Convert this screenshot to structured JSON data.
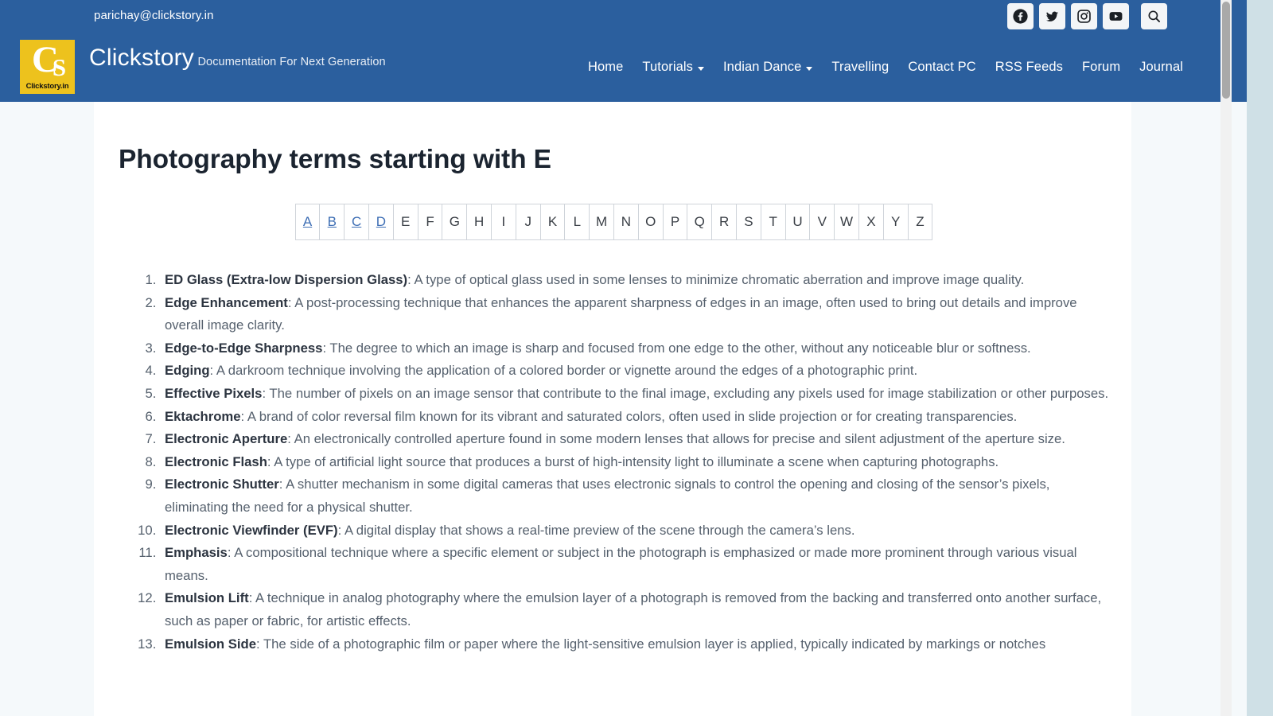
{
  "topbar": {
    "email": "parichay@clickstory.in",
    "social": [
      {
        "name": "facebook-icon",
        "label": "Facebook"
      },
      {
        "name": "twitter-icon",
        "label": "Twitter"
      },
      {
        "name": "instagram-icon",
        "label": "Instagram"
      },
      {
        "name": "youtube-icon",
        "label": "YouTube"
      }
    ],
    "search_label": "Search"
  },
  "header": {
    "logo_letters": "CS",
    "logo_caption": "Clickstory.in",
    "site_title": "Clickstory",
    "tagline": "Documentation For Next Generation",
    "nav": [
      {
        "label": "Home",
        "has_caret": false
      },
      {
        "label": "Tutorials",
        "has_caret": true
      },
      {
        "label": "Indian Dance",
        "has_caret": true
      },
      {
        "label": "Travelling",
        "has_caret": false
      },
      {
        "label": "Contact PC",
        "has_caret": false
      },
      {
        "label": "RSS Feeds",
        "has_caret": false
      },
      {
        "label": "Forum",
        "has_caret": false
      },
      {
        "label": "Journal",
        "has_caret": false
      }
    ]
  },
  "main": {
    "title": "Photography terms starting with E",
    "alphabet": [
      {
        "letter": "A",
        "linked": true
      },
      {
        "letter": "B",
        "linked": true
      },
      {
        "letter": "C",
        "linked": true
      },
      {
        "letter": "D",
        "linked": true
      },
      {
        "letter": "E",
        "linked": false
      },
      {
        "letter": "F",
        "linked": false
      },
      {
        "letter": "G",
        "linked": false
      },
      {
        "letter": "H",
        "linked": false
      },
      {
        "letter": "I",
        "linked": false
      },
      {
        "letter": "J",
        "linked": false
      },
      {
        "letter": "K",
        "linked": false
      },
      {
        "letter": "L",
        "linked": false
      },
      {
        "letter": "M",
        "linked": false
      },
      {
        "letter": "N",
        "linked": false
      },
      {
        "letter": "O",
        "linked": false
      },
      {
        "letter": "P",
        "linked": false
      },
      {
        "letter": "Q",
        "linked": false
      },
      {
        "letter": "R",
        "linked": false
      },
      {
        "letter": "S",
        "linked": false
      },
      {
        "letter": "T",
        "linked": false
      },
      {
        "letter": "U",
        "linked": false
      },
      {
        "letter": "V",
        "linked": false
      },
      {
        "letter": "W",
        "linked": false
      },
      {
        "letter": "X",
        "linked": false
      },
      {
        "letter": "Y",
        "linked": false
      },
      {
        "letter": "Z",
        "linked": false
      }
    ],
    "terms": [
      {
        "term": "ED Glass (Extra-low Dispersion Glass)",
        "definition": ": A type of optical glass used in some lenses to minimize chromatic aberration and improve image quality."
      },
      {
        "term": "Edge Enhancement",
        "definition": ": A post-processing technique that enhances the apparent sharpness of edges in an image, often used to bring out details and improve overall image clarity."
      },
      {
        "term": "Edge-to-Edge Sharpness",
        "definition": ": The degree to which an image is sharp and focused from one edge to the other, without any noticeable blur or softness."
      },
      {
        "term": "Edging",
        "definition": ": A darkroom technique involving the application of a colored border or vignette around the edges of a photographic print."
      },
      {
        "term": "Effective Pixels",
        "definition": ": The number of pixels on an image sensor that contribute to the final image, excluding any pixels used for image stabilization or other purposes."
      },
      {
        "term": "Ektachrome",
        "definition": ": A brand of color reversal film known for its vibrant and saturated colors, often used in slide projection or for creating transparencies."
      },
      {
        "term": "Electronic Aperture",
        "definition": ": An electronically controlled aperture found in some modern lenses that allows for precise and silent adjustment of the aperture size."
      },
      {
        "term": "Electronic Flash",
        "definition": ": A type of artificial light source that produces a burst of high-intensity light to illuminate a scene when capturing photographs."
      },
      {
        "term": "Electronic Shutter",
        "definition": ": A shutter mechanism in some digital cameras that uses electronic signals to control the opening and closing of the sensor’s pixels, eliminating the need for a physical shutter."
      },
      {
        "term": "Electronic Viewfinder (EVF)",
        "definition": ": A digital display that shows a real-time preview of the scene through the camera’s lens."
      },
      {
        "term": "Emphasis",
        "definition": ": A compositional technique where a specific element or subject in the photograph is emphasized or made more prominent through various visual means."
      },
      {
        "term": "Emulsion Lift",
        "definition": ": A technique in analog photography where the emulsion layer of a photograph is removed from the backing and transferred onto another surface, such as paper or fabric, for artistic effects."
      },
      {
        "term": "Emulsion Side",
        "definition": ": The side of a photographic film or paper where the light-sensitive emulsion layer is applied, typically indicated by markings or notches"
      }
    ]
  },
  "colors": {
    "brand_blue": "#2b5f9e",
    "logo_yellow": "#edc21d",
    "link_blue": "#3f6fb5",
    "body_text": "#55606d"
  }
}
